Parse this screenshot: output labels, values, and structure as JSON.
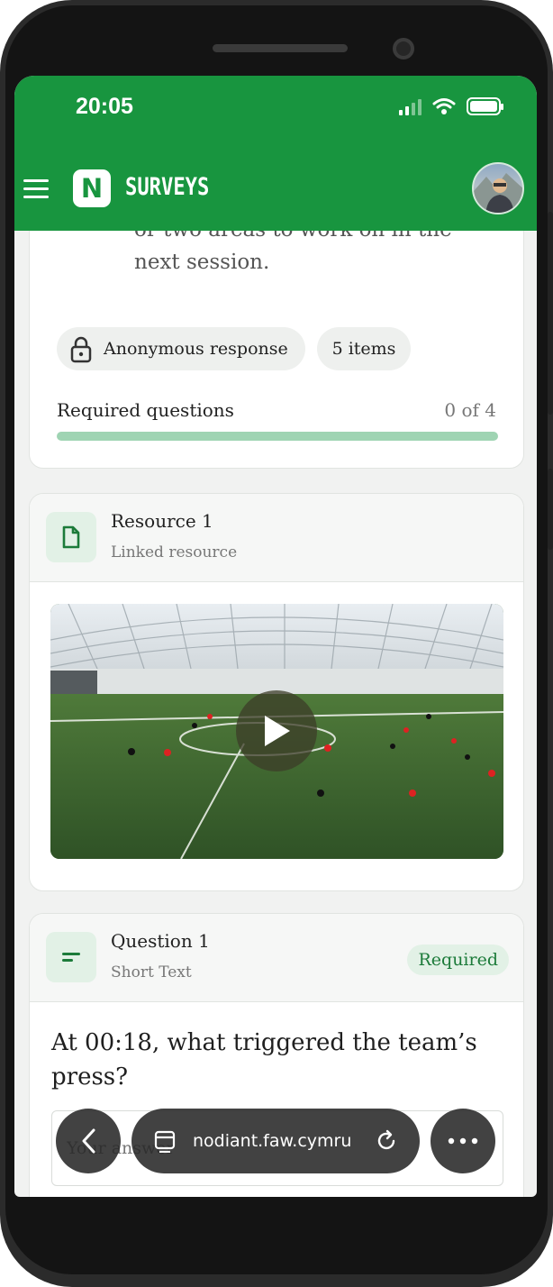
{
  "status": {
    "time": "20:05"
  },
  "app": {
    "logo_letter": "N",
    "brand": "SURVEYS"
  },
  "survey": {
    "description_fragment": "or two areas to work on in the next session.",
    "chips": {
      "anonymous": "Anonymous response",
      "items": "5 items"
    },
    "required": {
      "label": "Required questions",
      "count": "0 of 4",
      "progress_fraction": 0
    }
  },
  "resource": {
    "title": "Resource 1",
    "subtitle": "Linked resource"
  },
  "question": {
    "title": "Question 1",
    "type": "Short Text",
    "badge": "Required",
    "text": "At 00:18, what triggered the team’s press?",
    "placeholder": "Your answer"
  },
  "browser": {
    "url": "nodiant.faw.cymru"
  },
  "colors": {
    "brand_green": "#18953f",
    "light_green": "#e2f1e6",
    "progress_track": "#9fd4b3"
  },
  "icons": {
    "menu": "hamburger-icon",
    "lock": "lock-icon",
    "file": "file-icon",
    "text": "short-text-icon",
    "play": "play-icon",
    "back": "chevron-left-icon",
    "tabs": "tabs-icon",
    "reload": "reload-icon",
    "more": "more-icon"
  }
}
